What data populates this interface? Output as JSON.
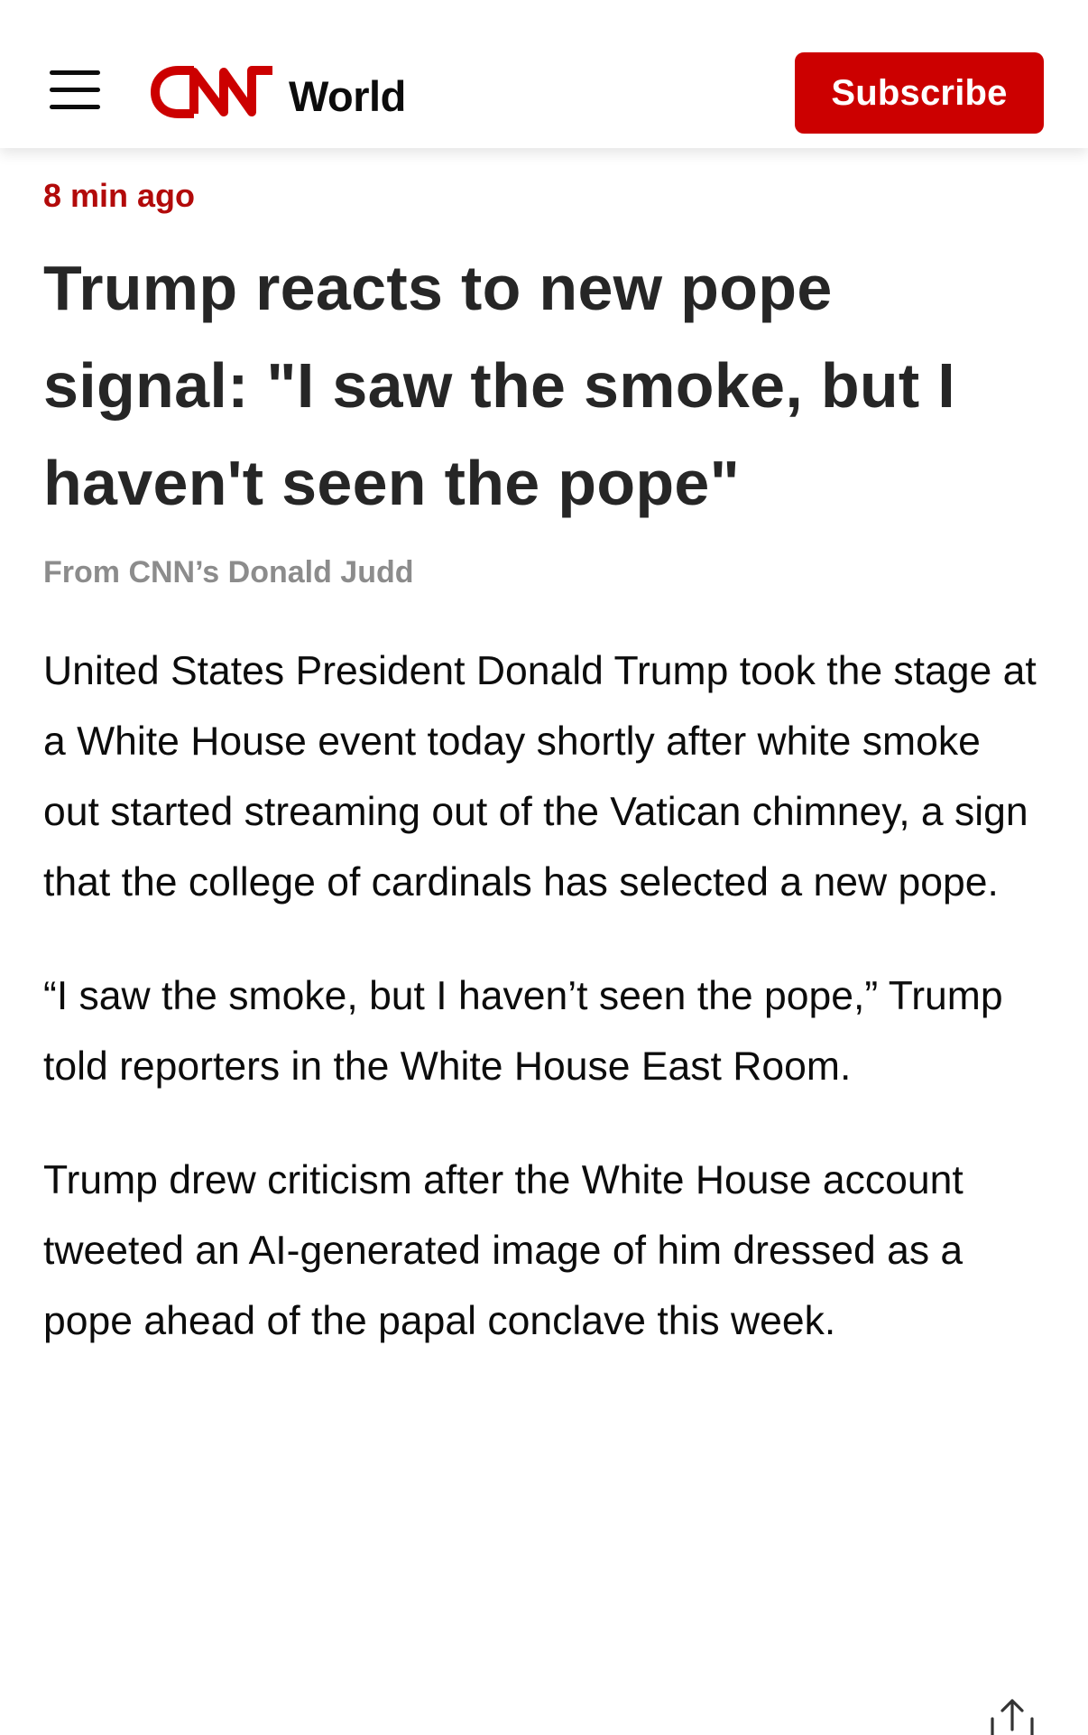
{
  "header": {
    "brand": "CNN",
    "section": "World",
    "subscribe_label": "Subscribe",
    "menu_icon": "hamburger-menu-icon"
  },
  "colors": {
    "brand_red": "#cc0000",
    "timestamp_red": "#b20a0a",
    "byline_gray": "#8c8c8c",
    "headline_text": "#262626"
  },
  "article": {
    "timestamp": "8 min ago",
    "headline": "Trump reacts to new pope signal: \"I saw the smoke, but I haven't seen the pope\"",
    "byline": "From CNN’s Donald Judd",
    "paragraphs": [
      "United States President Donald Trump took the stage at a White House event today shortly after white smoke out started streaming out of the Vatican chimney, a sign that the college of cardinals has selected a new pope.",
      "“I saw the smoke, but I haven’t seen the pope,” Trump told reporters in the White House East Room.",
      "Trump drew criticism after the White House account tweeted an AI-generated image of him dressed as a pope ahead of the papal conclave this week."
    ]
  },
  "footer": {
    "share_icon": "share-icon"
  }
}
